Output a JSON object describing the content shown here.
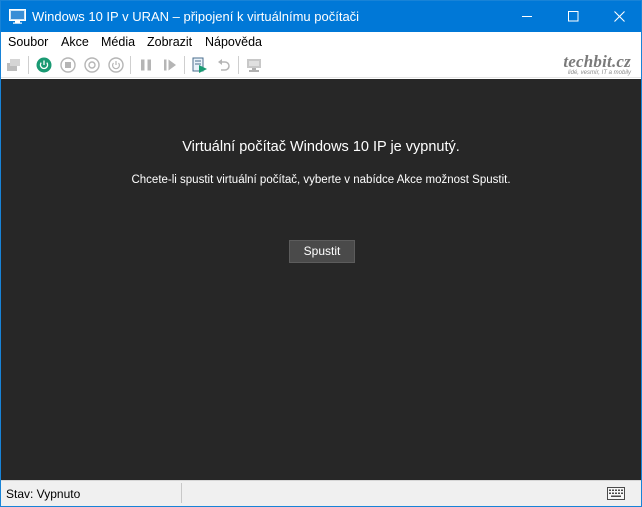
{
  "window": {
    "title": "Windows 10 IP v URAN – připojení k virtuálnímu počítači",
    "accent_color": "#0078d7"
  },
  "title_buttons": {
    "minimize_icon": "minimize-icon",
    "maximize_icon": "maximize-icon",
    "close_icon": "close-icon"
  },
  "menu": {
    "items": [
      "Soubor",
      "Akce",
      "Média",
      "Zobrazit",
      "Nápověda"
    ]
  },
  "toolbar": {
    "buttons": [
      "ctrl-alt-del-icon",
      "start-icon",
      "turn-off-icon",
      "shut-down-icon",
      "save-icon",
      "pause-icon",
      "resume-icon",
      "checkpoint-icon",
      "revert-icon",
      "enhanced-session-icon"
    ]
  },
  "brand": {
    "name": "techbit.cz",
    "tagline": "lidé, vesmír, IT a mobily"
  },
  "vm": {
    "heading": "Virtuální počítač Windows 10 IP je vypnutý.",
    "message": "Chcete-li spustit virtuální počítač, vyberte v nabídce Akce možnost Spustit.",
    "start_button": "Spustit",
    "background_color": "#272727"
  },
  "status": {
    "text": "Stav: Vypnuto",
    "keyboard_icon": "keyboard-icon"
  }
}
